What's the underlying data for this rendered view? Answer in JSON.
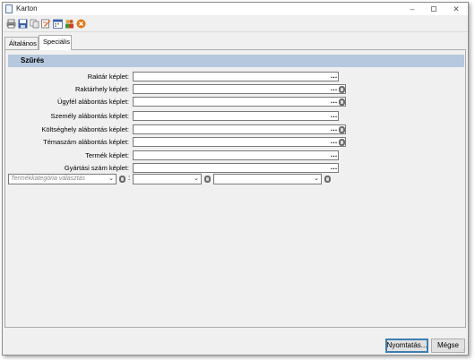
{
  "window": {
    "title": "Karton"
  },
  "toolbar": {
    "icons": [
      "printer-icon",
      "save-icon",
      "copy-icon",
      "edit-icon",
      "calendar-icon",
      "people-icon",
      "close-circle-icon"
    ]
  },
  "tabs": [
    {
      "label": "Általános",
      "active": false
    },
    {
      "label": "Speciális",
      "active": true
    }
  ],
  "section": {
    "title": "Szűrés"
  },
  "fields": [
    {
      "label": "Raktár képlet:",
      "dots": "…",
      "has_db": false
    },
    {
      "label": "Raktárhely képlet:",
      "dots": "…",
      "has_db": true
    },
    {
      "label": "Ügyfél alábontás képlet:",
      "dots": "…",
      "has_db": true
    },
    {
      "label": "Személy alábontás képlet:",
      "dots": "…",
      "has_db": false
    },
    {
      "label": "Költséghely alábontás képlet:",
      "dots": "…",
      "has_db": true
    },
    {
      "label": "Témaszám alábontás képlet:",
      "dots": "…",
      "has_db": true
    },
    {
      "label": "Termék képlet:",
      "dots": "…",
      "has_db": false
    },
    {
      "label": "Gyártási szám képlet:",
      "dots": "…",
      "has_db": false
    }
  ],
  "category_row": {
    "placeholder": "Termékkategória választás",
    "separator": ":"
  },
  "buttons": {
    "print": "Nyomtatás...",
    "cancel": "Mégse"
  },
  "colors": {
    "section_header": "#b5c8de",
    "accent_border": "#3c7fb1"
  }
}
